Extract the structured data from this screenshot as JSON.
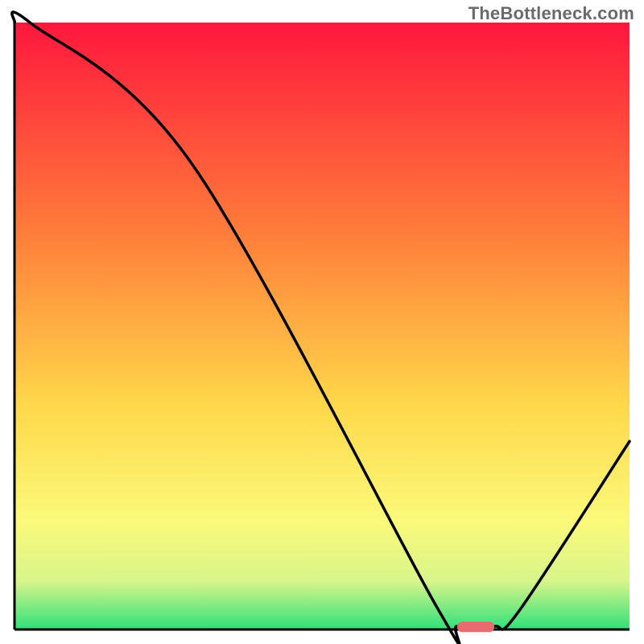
{
  "watermark": "TheBottleneck.com",
  "colors": {
    "stroke": "#000000",
    "marker_fill": "#e96a6f",
    "grad_top": "#ff173d",
    "grad_mid1": "#ff7e3a",
    "grad_mid2": "#ffd84a",
    "grad_mid3": "#fbf97a",
    "grad_mid4": "#d8f58a",
    "grad_bottom": "#2fe07a"
  },
  "chart_data": {
    "type": "line",
    "title": "",
    "xlabel": "",
    "ylabel": "",
    "xlim": [
      0,
      100
    ],
    "ylim": [
      0,
      100
    ],
    "x": [
      0,
      2.5,
      29,
      68.5,
      72,
      78,
      82,
      100
    ],
    "values": [
      100,
      100,
      76.5,
      4,
      0.5,
      0.5,
      3,
      31
    ],
    "marker": {
      "x_start": 72,
      "x_end": 78,
      "y": 0.5
    },
    "notes": "Background is a vertical red→green gradient (through orange/yellow). Black curve starts at top-left, dips to a short flat minimum near x≈72–78, then rises to the right edge at ~31% height."
  }
}
